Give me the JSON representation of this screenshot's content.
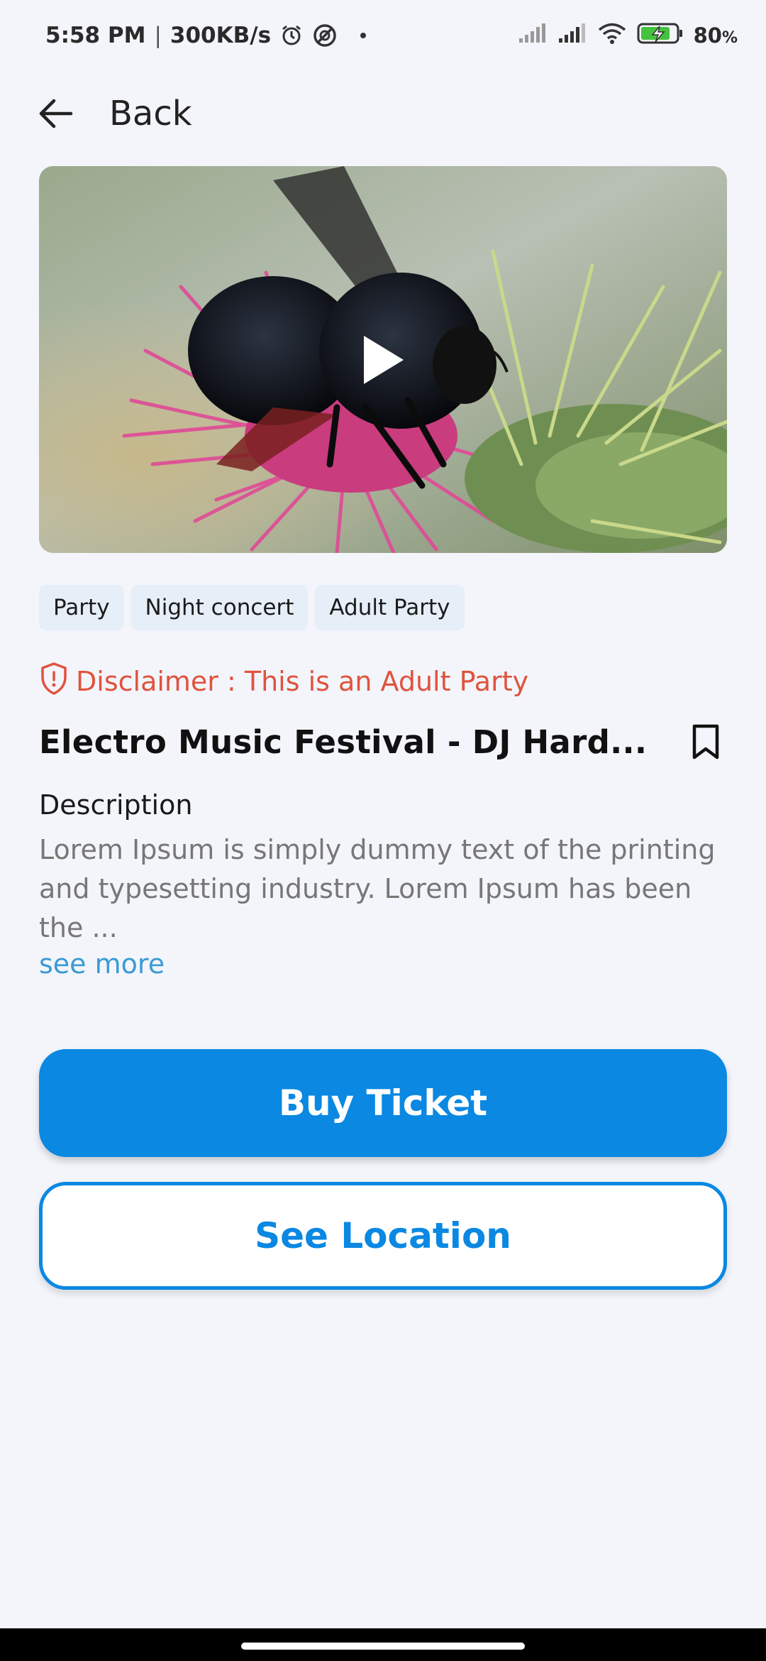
{
  "status_bar": {
    "time": "5:58 PM",
    "separator": "|",
    "speed": "300KB/s",
    "battery": "80",
    "battery_unit": "%",
    "icons": [
      "alarm-icon",
      "vpn-icon",
      "signal-icon",
      "signal-icon",
      "wifi-icon",
      "battery-charging-icon"
    ]
  },
  "header": {
    "back_label": "Back",
    "back_icon": "arrow-left-icon"
  },
  "media": {
    "play_icon": "play-icon"
  },
  "tags": [
    "Party",
    "Night concert",
    "Adult Party"
  ],
  "disclaimer": {
    "icon": "shield-alert-icon",
    "text": "Disclaimer : This is an Adult Party",
    "color": "#e0533d"
  },
  "event": {
    "title": "Electro Music Festival - DJ Hard...",
    "bookmark_icon": "bookmark-icon"
  },
  "description": {
    "heading": "Description",
    "body": "Lorem Ipsum is simply dummy text of the printing and typesetting industry. Lorem Ipsum has been the ...",
    "see_more": "see more",
    "link_color": "#3a9bd4"
  },
  "actions": {
    "buy_label": "Buy Ticket",
    "location_label": "See Location",
    "accent": "#0a88e2"
  }
}
